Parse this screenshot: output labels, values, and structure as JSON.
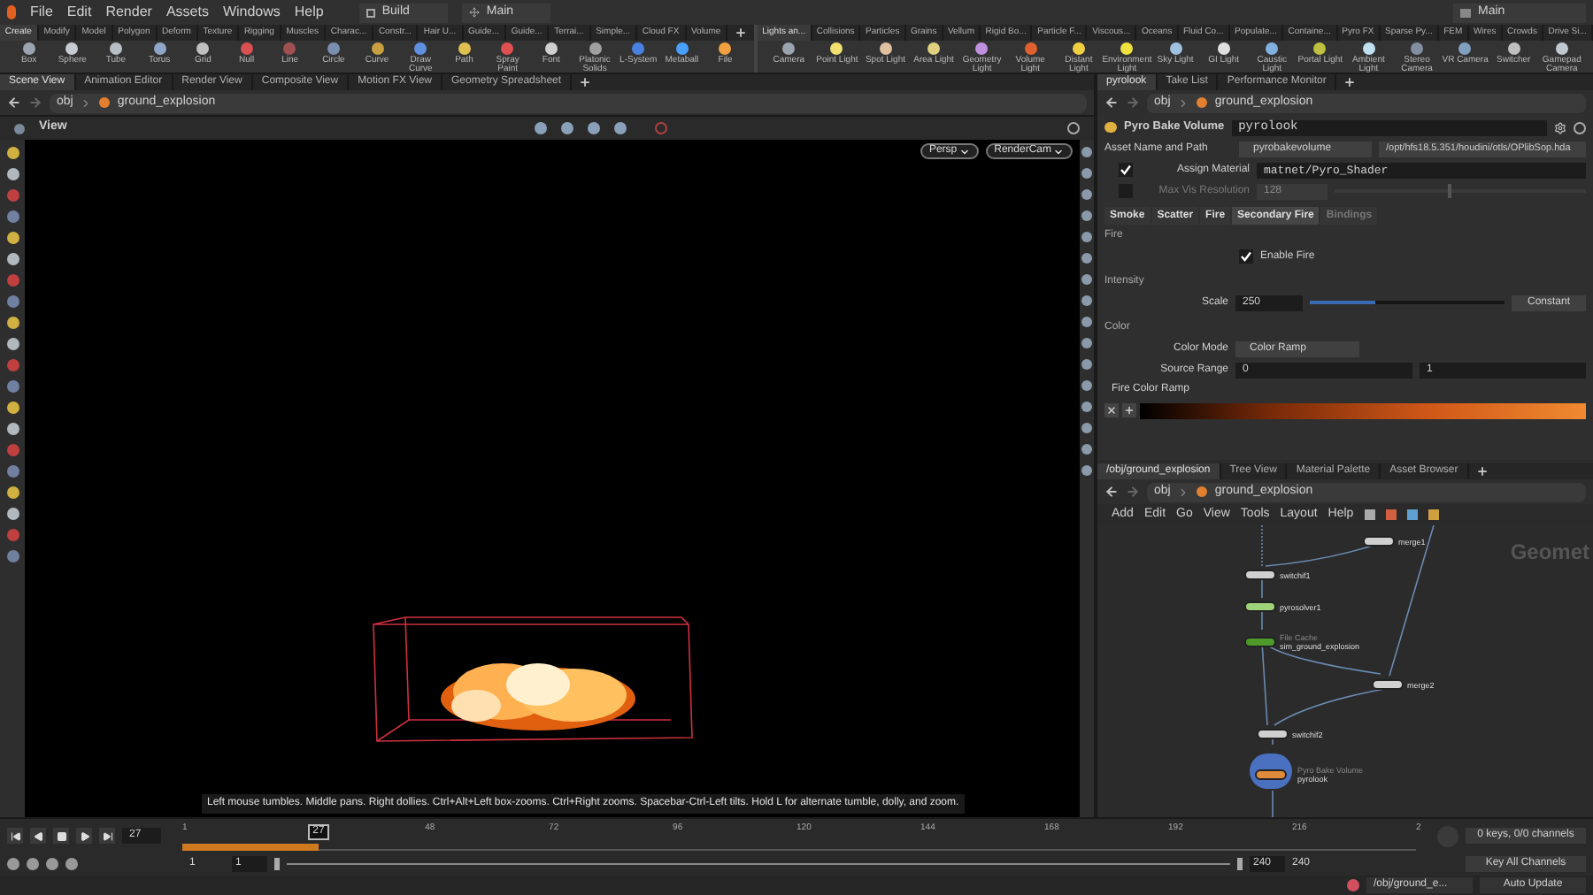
{
  "menu_bar": {
    "items": [
      "File",
      "Edit",
      "Render",
      "Assets",
      "Windows",
      "Help"
    ],
    "desktop": "Build",
    "workspace": "Main",
    "right_workspace": "Main"
  },
  "shelf": {
    "left_tabs": [
      {
        "label": "Create",
        "selected": true
      },
      {
        "label": "Modify",
        "selected": false
      },
      {
        "label": "Model",
        "selected": false
      },
      {
        "label": "Polygon",
        "selected": false
      },
      {
        "label": "Deform",
        "selected": false
      },
      {
        "label": "Texture",
        "selected": false
      },
      {
        "label": "Rigging",
        "selected": false
      },
      {
        "label": "Muscles",
        "selected": false
      },
      {
        "label": "Charac...",
        "selected": false
      },
      {
        "label": "Constr...",
        "selected": false
      },
      {
        "label": "Hair U...",
        "selected": false
      },
      {
        "label": "Guide...",
        "selected": false
      },
      {
        "label": "Guide...",
        "selected": false
      },
      {
        "label": "Terrai...",
        "selected": false
      },
      {
        "label": "Simple...",
        "selected": false
      },
      {
        "label": "Cloud FX",
        "selected": false
      },
      {
        "label": "Volume",
        "selected": false
      }
    ],
    "left_tools": [
      "Box",
      "Sphere",
      "Tube",
      "Torus",
      "Grid",
      "Null",
      "Line",
      "Circle",
      "Curve",
      "Draw Curve",
      "Path",
      "Spray Paint",
      "Font",
      "Platonic Solids",
      "L-System",
      "Metaball",
      "File"
    ],
    "right_tabs": [
      {
        "label": "Lights an...",
        "selected": true
      },
      {
        "label": "Collisions",
        "selected": false
      },
      {
        "label": "Particles",
        "selected": false
      },
      {
        "label": "Grains",
        "selected": false
      },
      {
        "label": "Vellum",
        "selected": false
      },
      {
        "label": "Rigid Bo...",
        "selected": false
      },
      {
        "label": "Particle F...",
        "selected": false
      },
      {
        "label": "Viscous...",
        "selected": false
      },
      {
        "label": "Oceans",
        "selected": false
      },
      {
        "label": "Fluid Co...",
        "selected": false
      },
      {
        "label": "Populate...",
        "selected": false
      },
      {
        "label": "Containe...",
        "selected": false
      },
      {
        "label": "Pyro FX",
        "selected": false
      },
      {
        "label": "Sparse Py...",
        "selected": false
      },
      {
        "label": "FEM",
        "selected": false
      },
      {
        "label": "Wires",
        "selected": false
      },
      {
        "label": "Crowds",
        "selected": false
      },
      {
        "label": "Drive Si...",
        "selected": false
      }
    ],
    "right_tools": [
      "Camera",
      "Point Light",
      "Spot Light",
      "Area Light",
      "Geometry Light",
      "Volume Light",
      "Distant Light",
      "Environment Light",
      "Sky Light",
      "GI Light",
      "Caustic Light",
      "Portal Light",
      "Ambient Light",
      "Stereo Camera",
      "VR Camera",
      "Switcher",
      "Gamepad Camera"
    ]
  },
  "scene_pane": {
    "tabs": [
      {
        "label": "Scene View",
        "selected": true
      },
      {
        "label": "Animation Editor",
        "selected": false
      },
      {
        "label": "Render View",
        "selected": false
      },
      {
        "label": "Composite View",
        "selected": false
      },
      {
        "label": "Motion FX View",
        "selected": false
      },
      {
        "label": "Geometry Spreadsheet",
        "selected": false
      }
    ],
    "path": [
      "obj",
      "ground_explosion"
    ],
    "view_label": "View",
    "camera_buttons": [
      "Persp",
      "RenderCam"
    ],
    "tooltip": "Left mouse tumbles. Middle pans. Right dollies. Ctrl+Alt+Left box-zooms. Ctrl+Right zooms. Spacebar-Ctrl-Left tilts. Hold L for alternate tumble, dolly, and zoom."
  },
  "parameter_pane": {
    "tabs": [
      {
        "label": "pyrolook",
        "selected": true
      },
      {
        "label": "Take List",
        "selected": false
      },
      {
        "label": "Performance Monitor",
        "selected": false
      }
    ],
    "path": [
      "obj",
      "ground_explosion"
    ],
    "node_type": "Pyro Bake Volume",
    "node_name": "pyrolook",
    "asset_label": "Asset Name and Path",
    "asset_name": "pyrobakevolume",
    "asset_path": "/opt/hfs18.5.351/houdini/otls/OPlibSop.hda",
    "assign_material": {
      "label": "Assign Material",
      "checked": true,
      "value": "matnet/Pyro_Shader"
    },
    "max_vis": {
      "label": "Max Vis Resolution",
      "checked": false,
      "value": "128",
      "level": 0.45
    },
    "tabs2": [
      {
        "label": "Smoke",
        "selected": false,
        "disabled": false
      },
      {
        "label": "Scatter",
        "selected": false,
        "disabled": false
      },
      {
        "label": "Fire",
        "selected": false,
        "disabled": false
      },
      {
        "label": "Secondary Fire",
        "selected": true,
        "disabled": false
      },
      {
        "label": "Bindings",
        "selected": false,
        "disabled": true
      }
    ],
    "fire_section": "Fire",
    "enable_fire": {
      "label": "Enable Fire",
      "checked": true
    },
    "intensity_section": "Intensity",
    "scale": {
      "label": "Scale",
      "value": "250",
      "level": 0.34,
      "mode": "Constant"
    },
    "color_section": "Color",
    "color_mode": {
      "label": "Color Mode",
      "value": "Color Ramp"
    },
    "source_range": {
      "label": "Source Range",
      "min": "0",
      "max": "1"
    },
    "ramp_label": "Fire Color Ramp"
  },
  "network_pane": {
    "tabs": [
      {
        "label": "/obj/ground_explosion",
        "selected": true
      },
      {
        "label": "Tree View",
        "selected": false
      },
      {
        "label": "Material Palette",
        "selected": false
      },
      {
        "label": "Asset Browser",
        "selected": false
      }
    ],
    "path": [
      "obj",
      "ground_explosion"
    ],
    "menu": [
      "Add",
      "Edit",
      "Go",
      "View",
      "Tools",
      "Layout",
      "Help"
    ],
    "context_label": "Geomet",
    "nodes": [
      {
        "name": "merge1",
        "color": "#d0d0d0",
        "display": false
      },
      {
        "name": "switchif1",
        "color": "#d0d0d0",
        "display": false
      },
      {
        "name": "pyrosolver1",
        "color": "#9fd37a",
        "display": false
      },
      {
        "name": "sim_ground_explosion",
        "subtitle": "File Cache",
        "color": "#4d9a2a",
        "display": false
      },
      {
        "name": "merge2",
        "color": "#d0d0d0",
        "display": false
      },
      {
        "name": "switchif2",
        "color": "#d0d0d0",
        "display": false
      },
      {
        "name": "pyrolook",
        "subtitle": "Pyro Bake Volume",
        "color": "#e08a3c",
        "display": true
      }
    ]
  },
  "timeline": {
    "frame": "27",
    "marker": "27",
    "level": 0.11,
    "ticks": [
      "1",
      "48",
      "72",
      "96",
      "120",
      "144",
      "168",
      "192",
      "216",
      "2"
    ],
    "keys": "0 keys, 0/0 channels",
    "key_button": "Key All Channels",
    "range": [
      "1",
      "1",
      "240",
      "240"
    ]
  },
  "status_bar": {
    "path": "/obj/ground_e...",
    "update": "Auto Update"
  }
}
